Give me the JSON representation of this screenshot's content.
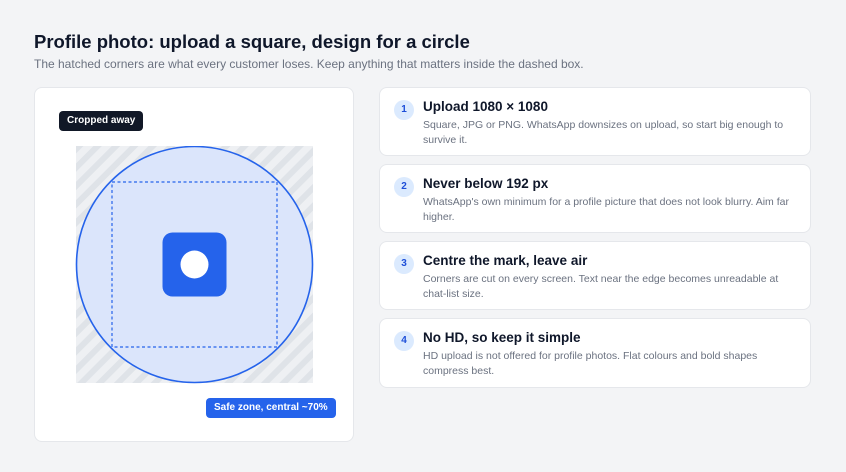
{
  "header": {
    "title": "Profile photo: upload a square, design for a circle",
    "subtitle": "The hatched corners are what every customer loses. Keep anything that matters inside the dashed box."
  },
  "diagram": {
    "cropped_label": "Cropped away",
    "safe_zone_label": "Safe zone, central ~70%",
    "colors": {
      "accent": "#2563eb",
      "circle_fill": "#dbe5fb",
      "hatch_bg": "#eef0f3",
      "hatch_stripe": "#dfe3e8",
      "dark_tag": "#111827"
    },
    "icon": "logo-mark-icon"
  },
  "steps": [
    {
      "number": "1",
      "title": "Upload 1080 × 1080",
      "description": "Square, JPG or PNG. WhatsApp downsizes on upload, so start big enough to survive it."
    },
    {
      "number": "2",
      "title": "Never below 192 px",
      "description": "WhatsApp's own minimum for a profile picture that does not look blurry. Aim far higher."
    },
    {
      "number": "3",
      "title": "Centre the mark, leave air",
      "description": "Corners are cut on every screen. Text near the edge becomes unreadable at chat-list size."
    },
    {
      "number": "4",
      "title": "No HD, so keep it simple",
      "description": "HD upload is not offered for profile photos. Flat colours and bold shapes compress best."
    }
  ]
}
